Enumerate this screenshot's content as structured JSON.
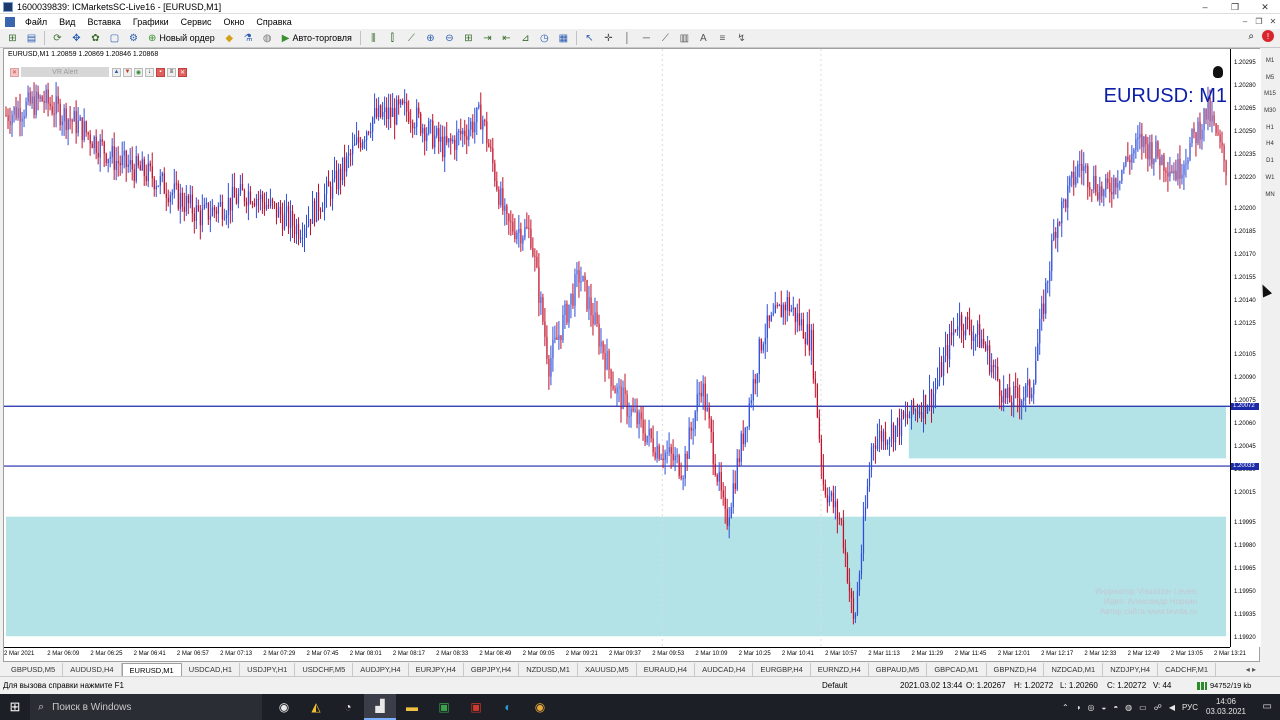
{
  "window": {
    "title": "1600039839: ICMarketsSC-Live16 - [EURUSD,M1]",
    "controls": [
      "–",
      "❐",
      "✕"
    ]
  },
  "menu": {
    "items": [
      "Файл",
      "Вид",
      "Вставка",
      "Графики",
      "Сервис",
      "Окно",
      "Справка"
    ],
    "mdi_controls": [
      "–",
      "❐",
      "✕"
    ]
  },
  "toolbar": {
    "new_order_label": "Новый ордер",
    "autotrading_label": "Авто-торговля"
  },
  "chart": {
    "header": "EURUSD,M1  1.20859 1.20869 1.20846 1.20868",
    "symbol_label": "EURUSD: M1",
    "vr_alert_label": "VR Alert",
    "credits": [
      "Индикатор Visualizer Levels",
      "Идея: Александр Норкин",
      "Автор сайта www.tevola.ru"
    ],
    "price_ticks": [
      "1.20295",
      "1.20280",
      "1.20265",
      "1.20250",
      "1.20235",
      "1.20220",
      "1.20200",
      "1.20185",
      "1.20170",
      "1.20155",
      "1.20140",
      "1.20125",
      "1.20105",
      "1.20090",
      "1.20075",
      "1.20060",
      "1.20045",
      "1.20030",
      "1.20015",
      "1.19995",
      "1.19980",
      "1.19965",
      "1.19950",
      "1.19935",
      "1.19920"
    ],
    "price_tags": [
      "1.20072",
      "1.20033"
    ],
    "time_ticks": [
      "2 Mar 2021",
      "2 Mar 06:09",
      "2 Mar 06:25",
      "2 Mar 06:41",
      "2 Mar 06:57",
      "2 Mar 07:13",
      "2 Mar 07:29",
      "2 Mar 07:45",
      "2 Mar 08:01",
      "2 Mar 08:17",
      "2 Mar 08:33",
      "2 Mar 08:49",
      "2 Mar 09:05",
      "2 Mar 09:21",
      "2 Mar 09:37",
      "2 Mar 09:53",
      "2 Mar 10:09",
      "2 Mar 10:25",
      "2 Mar 10:41",
      "2 Mar 10:57",
      "2 Mar 11:13",
      "2 Mar 11:29",
      "2 Mar 11:45",
      "2 Mar 12:01",
      "2 Mar 12:17",
      "2 Mar 12:33",
      "2 Mar 12:49",
      "2 Mar 13:05",
      "2 Mar 13:21"
    ],
    "timeframes": [
      "M1",
      "M5",
      "M15",
      "M30",
      "H1",
      "H4",
      "D1",
      "W1",
      "MN"
    ],
    "colors": {
      "bull": "#2f4fd8",
      "bear": "#c0102a",
      "zone": "#b3e3e6",
      "level_line": "#1c2aa8"
    }
  },
  "chart_data": {
    "type": "candlestick",
    "title": "EURUSD: M1",
    "ylim": [
      1.19915,
      1.20305
    ],
    "x_range": [
      "2 Mar 2021",
      "2 Mar 13:21"
    ],
    "path_anchors": [
      {
        "t": 0.0,
        "p": 1.20262
      },
      {
        "t": 0.03,
        "p": 1.20272
      },
      {
        "t": 0.06,
        "p": 1.20255
      },
      {
        "t": 0.09,
        "p": 1.20232
      },
      {
        "t": 0.12,
        "p": 1.20222
      },
      {
        "t": 0.16,
        "p": 1.20196
      },
      {
        "t": 0.2,
        "p": 1.20212
      },
      {
        "t": 0.24,
        "p": 1.20188
      },
      {
        "t": 0.27,
        "p": 1.20218
      },
      {
        "t": 0.3,
        "p": 1.2026
      },
      {
        "t": 0.33,
        "p": 1.20265
      },
      {
        "t": 0.36,
        "p": 1.2024
      },
      {
        "t": 0.39,
        "p": 1.20262
      },
      {
        "t": 0.41,
        "p": 1.2019
      },
      {
        "t": 0.43,
        "p": 1.20185
      },
      {
        "t": 0.445,
        "p": 1.201
      },
      {
        "t": 0.47,
        "p": 1.20158
      },
      {
        "t": 0.5,
        "p": 1.20082
      },
      {
        "t": 0.53,
        "p": 1.20048
      },
      {
        "t": 0.555,
        "p": 1.20032
      },
      {
        "t": 0.57,
        "p": 1.20088
      },
      {
        "t": 0.59,
        "p": 1.19995
      },
      {
        "t": 0.62,
        "p": 1.20118
      },
      {
        "t": 0.64,
        "p": 1.2014
      },
      {
        "t": 0.66,
        "p": 1.20115
      },
      {
        "t": 0.67,
        "p": 1.20022
      },
      {
        "t": 0.685,
        "p": 1.19995
      },
      {
        "t": 0.695,
        "p": 1.19928
      },
      {
        "t": 0.71,
        "p": 1.2005
      },
      {
        "t": 0.73,
        "p": 1.20058
      },
      {
        "t": 0.76,
        "p": 1.2008
      },
      {
        "t": 0.78,
        "p": 1.2013
      },
      {
        "t": 0.8,
        "p": 1.20115
      },
      {
        "t": 0.82,
        "p": 1.20075
      },
      {
        "t": 0.84,
        "p": 1.20082
      },
      {
        "t": 0.86,
        "p": 1.2019
      },
      {
        "t": 0.88,
        "p": 1.2023
      },
      {
        "t": 0.9,
        "p": 1.2021
      },
      {
        "t": 0.93,
        "p": 1.20245
      },
      {
        "t": 0.96,
        "p": 1.20225
      },
      {
        "t": 0.985,
        "p": 1.20265
      },
      {
        "t": 1.0,
        "p": 1.20228
      }
    ],
    "levels": [
      1.20072,
      1.20033
    ],
    "zones": [
      {
        "from_t": 0.0,
        "to_t": 1.0,
        "low": 1.19922,
        "high": 1.2
      },
      {
        "from_t": 0.74,
        "to_t": 1.0,
        "low": 1.20038,
        "high": 1.20072
      }
    ]
  },
  "tabs": {
    "items": [
      "GBPUSD,M5",
      "AUDUSD,H4",
      "EURUSD,M1",
      "USDCAD,H1",
      "USDJPY,H1",
      "USDCHF,M5",
      "AUDJPY,H4",
      "EURJPY,H4",
      "GBPJPY,H4",
      "NZDUSD,M1",
      "XAUUSD,M5",
      "EURAUD,H4",
      "AUDCAD,H4",
      "EURGBP,H4",
      "EURNZD,H4",
      "GBPAUD,M5",
      "GBPCAD,M1",
      "GBPNZD,H4",
      "NZDCAD,M1",
      "NZDJPY,H4",
      "CADCHF,M1"
    ],
    "active_index": 2,
    "nav": "◂ ▸"
  },
  "status": {
    "help": "Для вызова справки нажмите F1",
    "profile": "Default",
    "datetime": "2021.03.02 13:44",
    "open": "O: 1.20267",
    "high": "H: 1.20272",
    "low": "L: 1.20260",
    "close": "C: 1.20272",
    "volume": "V: 44",
    "connection": "94752/19 kb"
  },
  "taskbar": {
    "search_placeholder": "Поиск в Windows",
    "lang": "РУС",
    "time": "14:06",
    "date": "03.03.2021"
  }
}
